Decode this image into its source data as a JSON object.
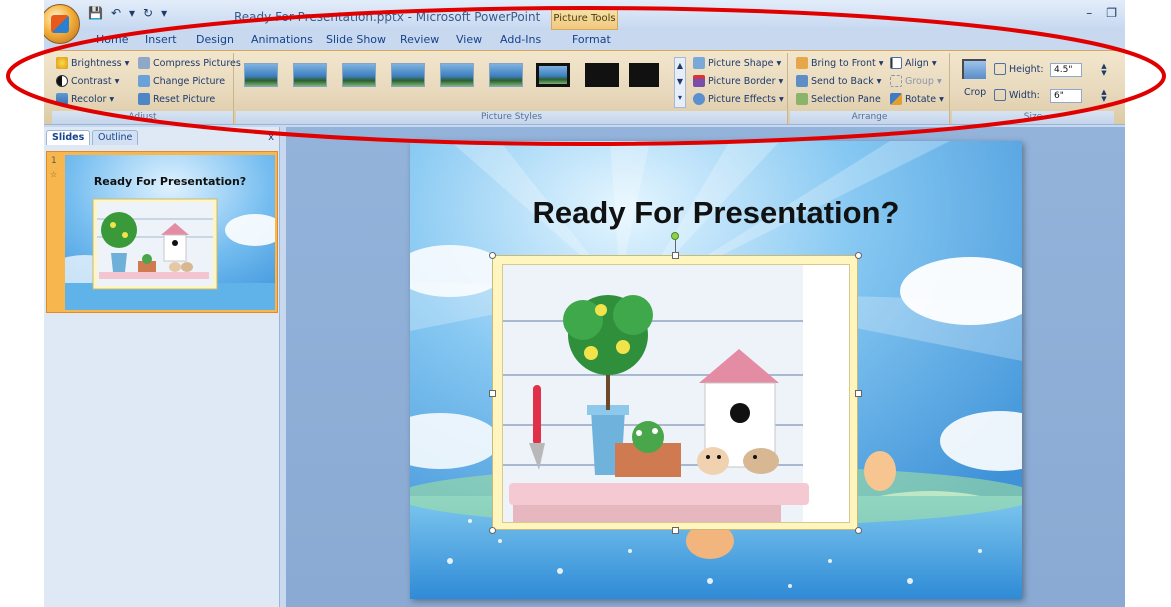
{
  "window": {
    "title": "Ready For Presentation.pptx - Microsoft PowerPoint",
    "context_tab_group": "Picture Tools"
  },
  "tabs": [
    "Home",
    "Insert",
    "Design",
    "Animations",
    "Slide Show",
    "Review",
    "View",
    "Add-Ins",
    "Format"
  ],
  "active_tab": "Format",
  "ribbon": {
    "adjust": {
      "brightness": "Brightness",
      "contrast": "Contrast",
      "recolor": "Recolor",
      "compress": "Compress Pictures",
      "change": "Change Picture",
      "reset": "Reset Picture",
      "label": "Adjust"
    },
    "picture_styles": {
      "shape": "Picture Shape",
      "border": "Picture Border",
      "effects": "Picture Effects",
      "label": "Picture Styles"
    },
    "arrange": {
      "bring_front": "Bring to Front",
      "send_back": "Send to Back",
      "selection_pane": "Selection Pane",
      "align": "Align",
      "group": "Group",
      "rotate": "Rotate",
      "label": "Arrange"
    },
    "size": {
      "crop": "Crop",
      "height_label": "Height:",
      "height_value": "4.5\"",
      "width_label": "Width:",
      "width_value": "6\"",
      "label": "Size"
    }
  },
  "left_panel": {
    "tab_slides": "Slides",
    "tab_outline": "Outline",
    "close": "x",
    "slide_number": "1"
  },
  "slide": {
    "title": "Ready For Presentation?"
  },
  "colors": {
    "annotation": "#e00000",
    "ribbon_accent": "#f7b64e",
    "slide_sky": "#6fb5ea"
  }
}
